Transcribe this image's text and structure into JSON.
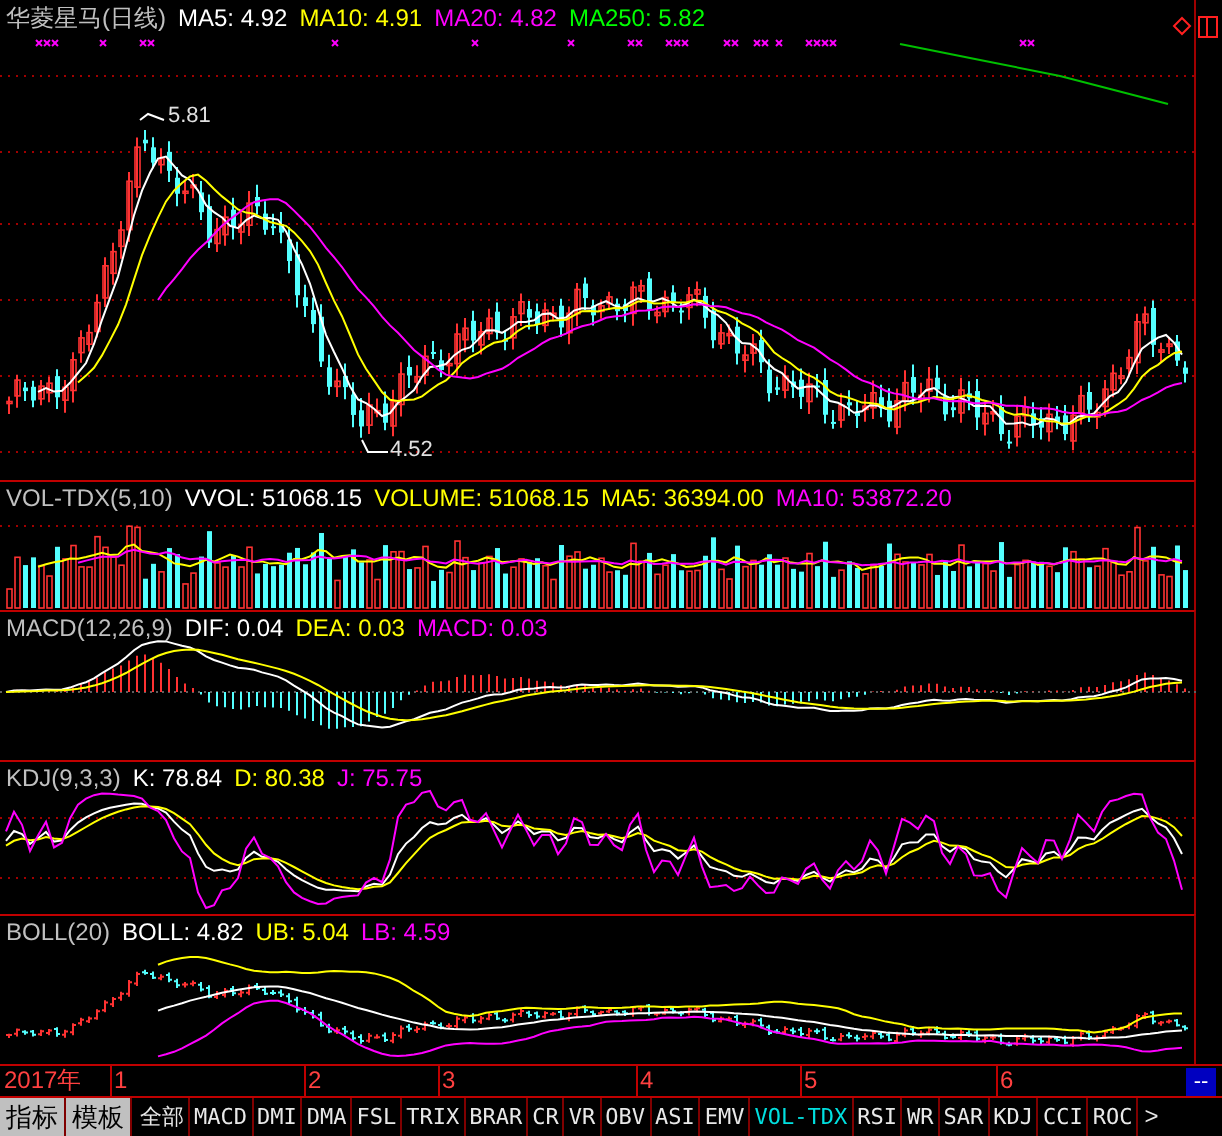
{
  "chart_title": "华菱星马(日线)",
  "main_legend": [
    {
      "text": "MA5: 4.92",
      "color": "#ffffff"
    },
    {
      "text": "MA10: 4.91",
      "color": "#ffff00"
    },
    {
      "text": "MA20: 4.82",
      "color": "#ff00ff"
    },
    {
      "text": "MA250: 5.82",
      "color": "#00ff00"
    }
  ],
  "price_labels": [
    {
      "kind": "high",
      "text": "5.81"
    },
    {
      "kind": "low",
      "text": "4.52"
    }
  ],
  "panels": [
    {
      "kind": "volume",
      "title": "VOL-TDX(5,10)",
      "legend": [
        {
          "text": "VVOL: 51068.15",
          "color": "#ffffff"
        },
        {
          "text": "VOLUME: 51068.15",
          "color": "#ffff00"
        },
        {
          "text": "MA5: 36394.00",
          "color": "#ffff00"
        },
        {
          "text": "MA10: 53872.20",
          "color": "#ff00ff"
        }
      ]
    },
    {
      "kind": "macd",
      "title": "MACD(12,26,9)",
      "legend": [
        {
          "text": "DIF: 0.04",
          "color": "#ffffff"
        },
        {
          "text": "DEA: 0.03",
          "color": "#ffff00"
        },
        {
          "text": "MACD: 0.03",
          "color": "#ff00ff"
        }
      ]
    },
    {
      "kind": "kdj",
      "title": "KDJ(9,3,3)",
      "legend": [
        {
          "text": "K: 78.84",
          "color": "#ffffff"
        },
        {
          "text": "D: 80.38",
          "color": "#ffff00"
        },
        {
          "text": "J: 75.75",
          "color": "#ff00ff"
        }
      ]
    },
    {
      "kind": "boll",
      "title": "BOLL(20)",
      "legend": [
        {
          "text": "BOLL: 4.82",
          "color": "#ffffff"
        },
        {
          "text": "UB: 5.04",
          "color": "#ffff00"
        },
        {
          "text": "LB: 4.59",
          "color": "#ff00ff"
        }
      ]
    }
  ],
  "date_axis": {
    "year": "2017年",
    "months": [
      "1",
      "2",
      "3",
      "4",
      "5",
      "6"
    ],
    "end_button": "--"
  },
  "tabs": [
    {
      "label": "指标",
      "kind": "mode",
      "selected": false
    },
    {
      "label": "模板",
      "kind": "mode",
      "selected": false
    },
    {
      "label": "全部",
      "kind": "indicator",
      "selected": false
    },
    {
      "label": "MACD",
      "kind": "indicator",
      "selected": false
    },
    {
      "label": "DMI",
      "kind": "indicator",
      "selected": false
    },
    {
      "label": "DMA",
      "kind": "indicator",
      "selected": false
    },
    {
      "label": "FSL",
      "kind": "indicator",
      "selected": false
    },
    {
      "label": "TRIX",
      "kind": "indicator",
      "selected": false
    },
    {
      "label": "BRAR",
      "kind": "indicator",
      "selected": false
    },
    {
      "label": "CR",
      "kind": "indicator",
      "selected": false
    },
    {
      "label": "VR",
      "kind": "indicator",
      "selected": false
    },
    {
      "label": "OBV",
      "kind": "indicator",
      "selected": false
    },
    {
      "label": "ASI",
      "kind": "indicator",
      "selected": false
    },
    {
      "label": "EMV",
      "kind": "indicator",
      "selected": false
    },
    {
      "label": "VOL-TDX",
      "kind": "indicator",
      "selected": true
    },
    {
      "label": "RSI",
      "kind": "indicator",
      "selected": false
    },
    {
      "label": "WR",
      "kind": "indicator",
      "selected": false
    },
    {
      "label": "SAR",
      "kind": "indicator",
      "selected": false
    },
    {
      "label": "KDJ",
      "kind": "indicator",
      "selected": false
    },
    {
      "label": "CCI",
      "kind": "indicator",
      "selected": false
    },
    {
      "label": "ROC",
      "kind": "indicator",
      "selected": false
    }
  ],
  "next_button": ">"
}
